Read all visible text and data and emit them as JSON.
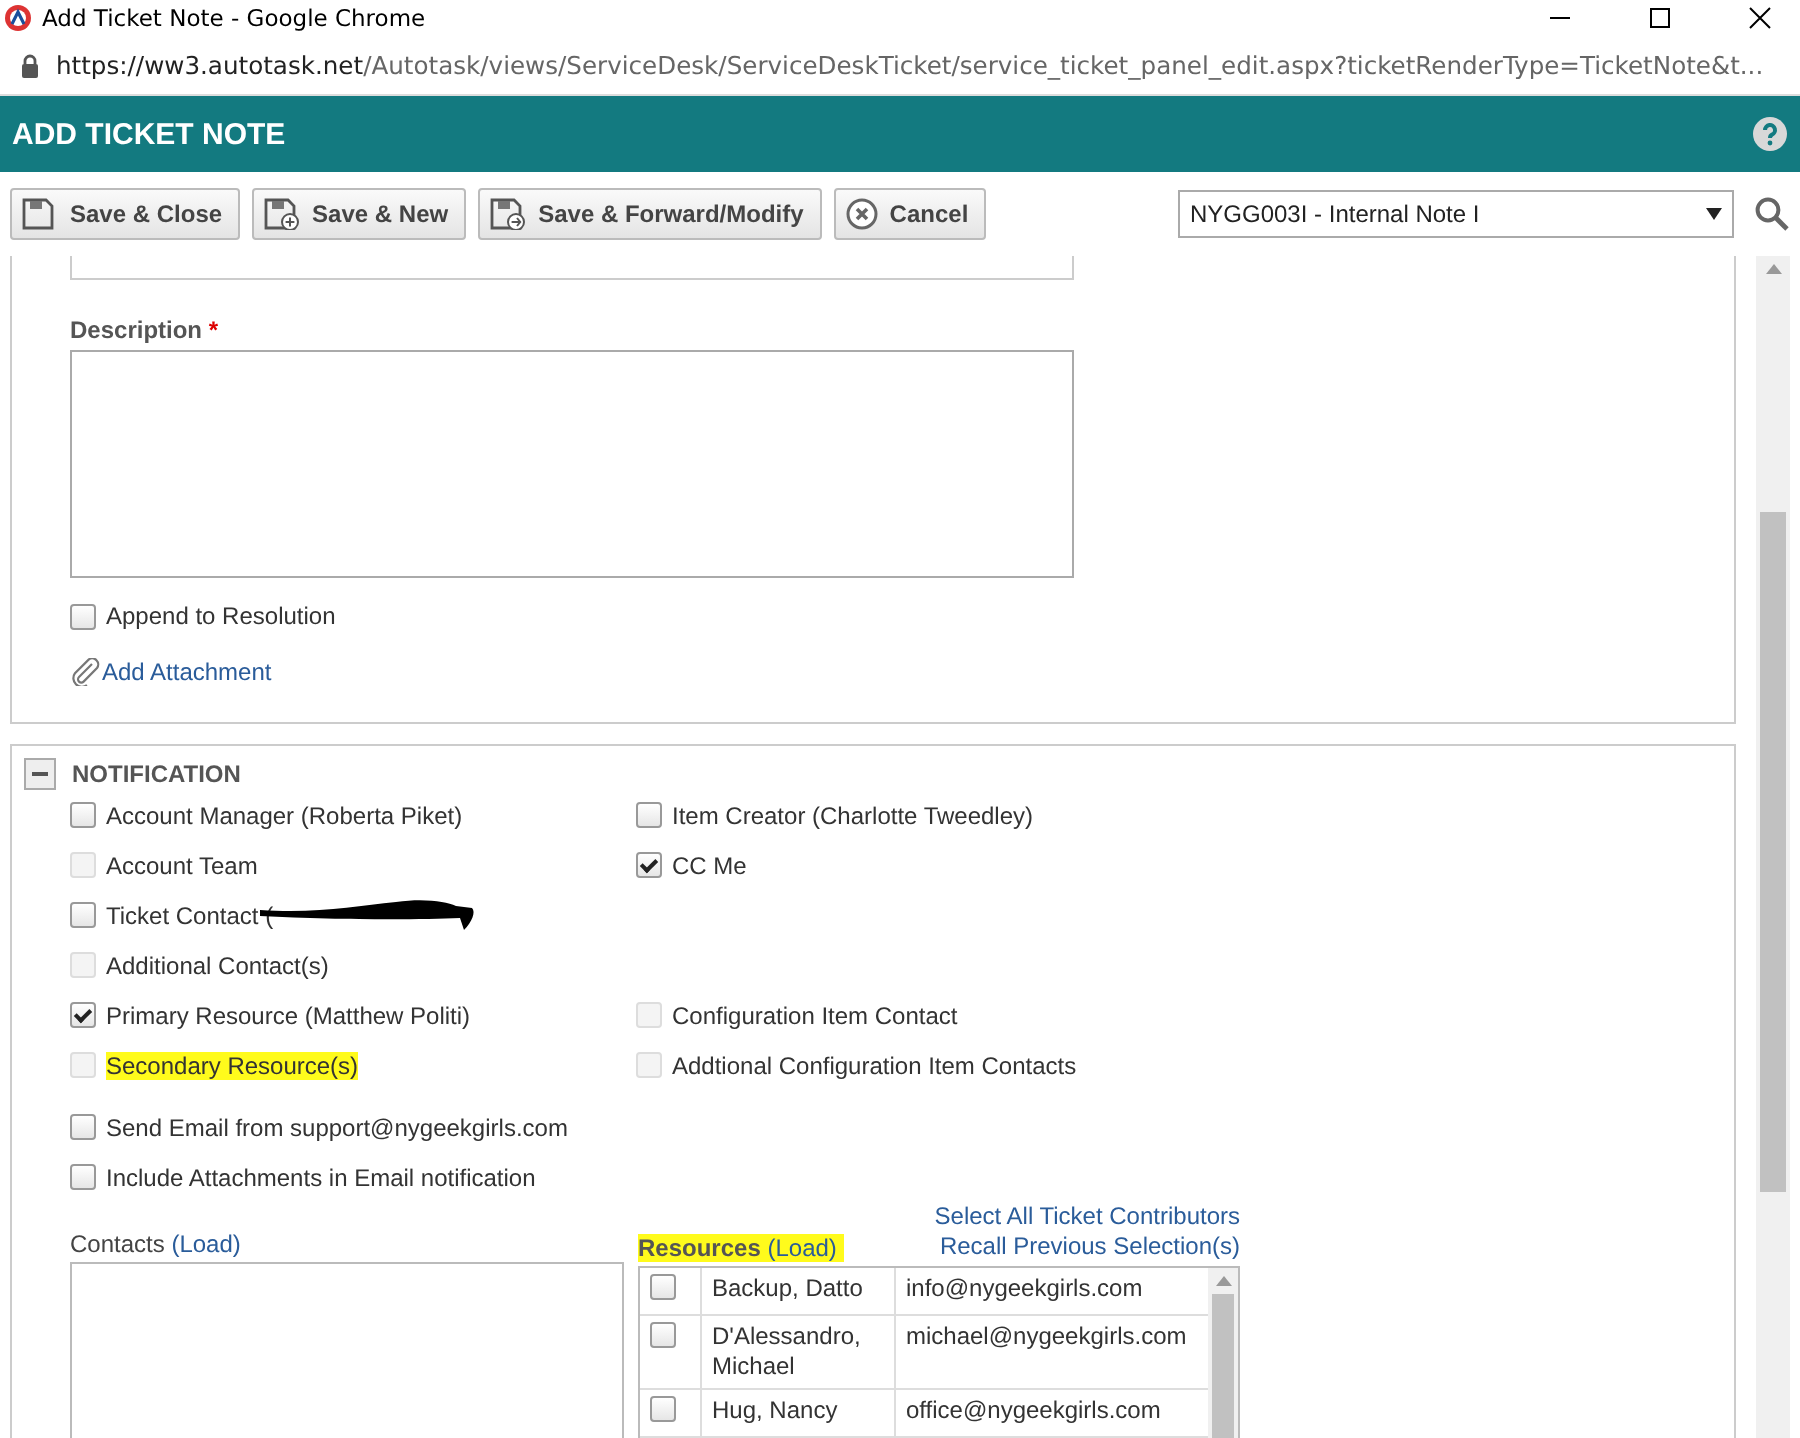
{
  "browser": {
    "title": "Add Ticket Note - Google Chrome",
    "url_host": "https://ww3.autotask.net",
    "url_path": "/Autotask/views/ServiceDesk/ServiceDeskTicket/service_ticket_panel_edit.aspx?ticketRenderType=TicketNote&t..."
  },
  "header": {
    "title": "ADD TICKET NOTE"
  },
  "toolbar": {
    "buttons": [
      {
        "label": "Save & Close",
        "kind": "save"
      },
      {
        "label": "Save & New",
        "kind": "save_new"
      },
      {
        "label": "Save & Forward/Modify",
        "kind": "save_forward"
      },
      {
        "label": "Cancel",
        "kind": "cancel"
      }
    ],
    "template": {
      "value": "NYGG003I - Internal Note I"
    }
  },
  "note_form": {
    "description_label": "Description",
    "required_mark": "*",
    "append": {
      "label": "Append to Resolution",
      "checked": false
    },
    "attachment_link": "Add Attachment"
  },
  "notification": {
    "title": "NOTIFICATION",
    "expanded": true,
    "rows": [
      {
        "left": {
          "label": "Account Manager (Roberta Piket)",
          "checked": false,
          "disabled": false,
          "highlighted": false,
          "redacted": false
        },
        "right": {
          "label": "Item Creator (Charlotte Tweedley)",
          "checked": false,
          "disabled": false
        }
      },
      {
        "left": {
          "label": "Account Team",
          "checked": false,
          "disabled": true,
          "highlighted": false,
          "redacted": false
        },
        "right": {
          "label": "CC Me",
          "checked": true,
          "disabled": false
        }
      },
      {
        "left": {
          "label": "Ticket Contact (",
          "checked": false,
          "disabled": false,
          "highlighted": false,
          "redacted": true
        }
      },
      {
        "left": {
          "label": "Additional Contact(s)",
          "checked": false,
          "disabled": true,
          "highlighted": false,
          "redacted": false
        }
      },
      {
        "left": {
          "label": "Primary Resource (Matthew Politi)",
          "checked": true,
          "disabled": false,
          "highlighted": false,
          "redacted": false
        },
        "right": {
          "label": "Configuration Item Contact",
          "checked": false,
          "disabled": true
        }
      },
      {
        "left": {
          "label": "Secondary Resource(s)",
          "checked": false,
          "disabled": true,
          "highlighted": true,
          "redacted": false
        },
        "right": {
          "label": "Addtional Configuration Item Contacts",
          "checked": false,
          "disabled": true
        }
      }
    ],
    "email_options": [
      {
        "label": "Send Email from support@nygeekgirls.com",
        "checked": false
      },
      {
        "label": "Include Attachments in Email notification",
        "checked": false
      }
    ],
    "contacts": {
      "label": "Contacts",
      "load_link": "(Load)"
    },
    "resources": {
      "label": "Resources",
      "load_link": "(Load)",
      "highlighted": true,
      "links": [
        "Select All Ticket Contributors",
        "Recall Previous Selection(s)"
      ],
      "rows": [
        {
          "name": "Backup, Datto",
          "email": "info@nygeekgirls.com",
          "checked": false
        },
        {
          "name": "D'Alessandro, Michael",
          "email": "michael@nygeekgirls.com",
          "checked": false
        },
        {
          "name": "Hug, Nancy",
          "email": "office@nygeekgirls.com",
          "checked": false
        }
      ]
    }
  }
}
